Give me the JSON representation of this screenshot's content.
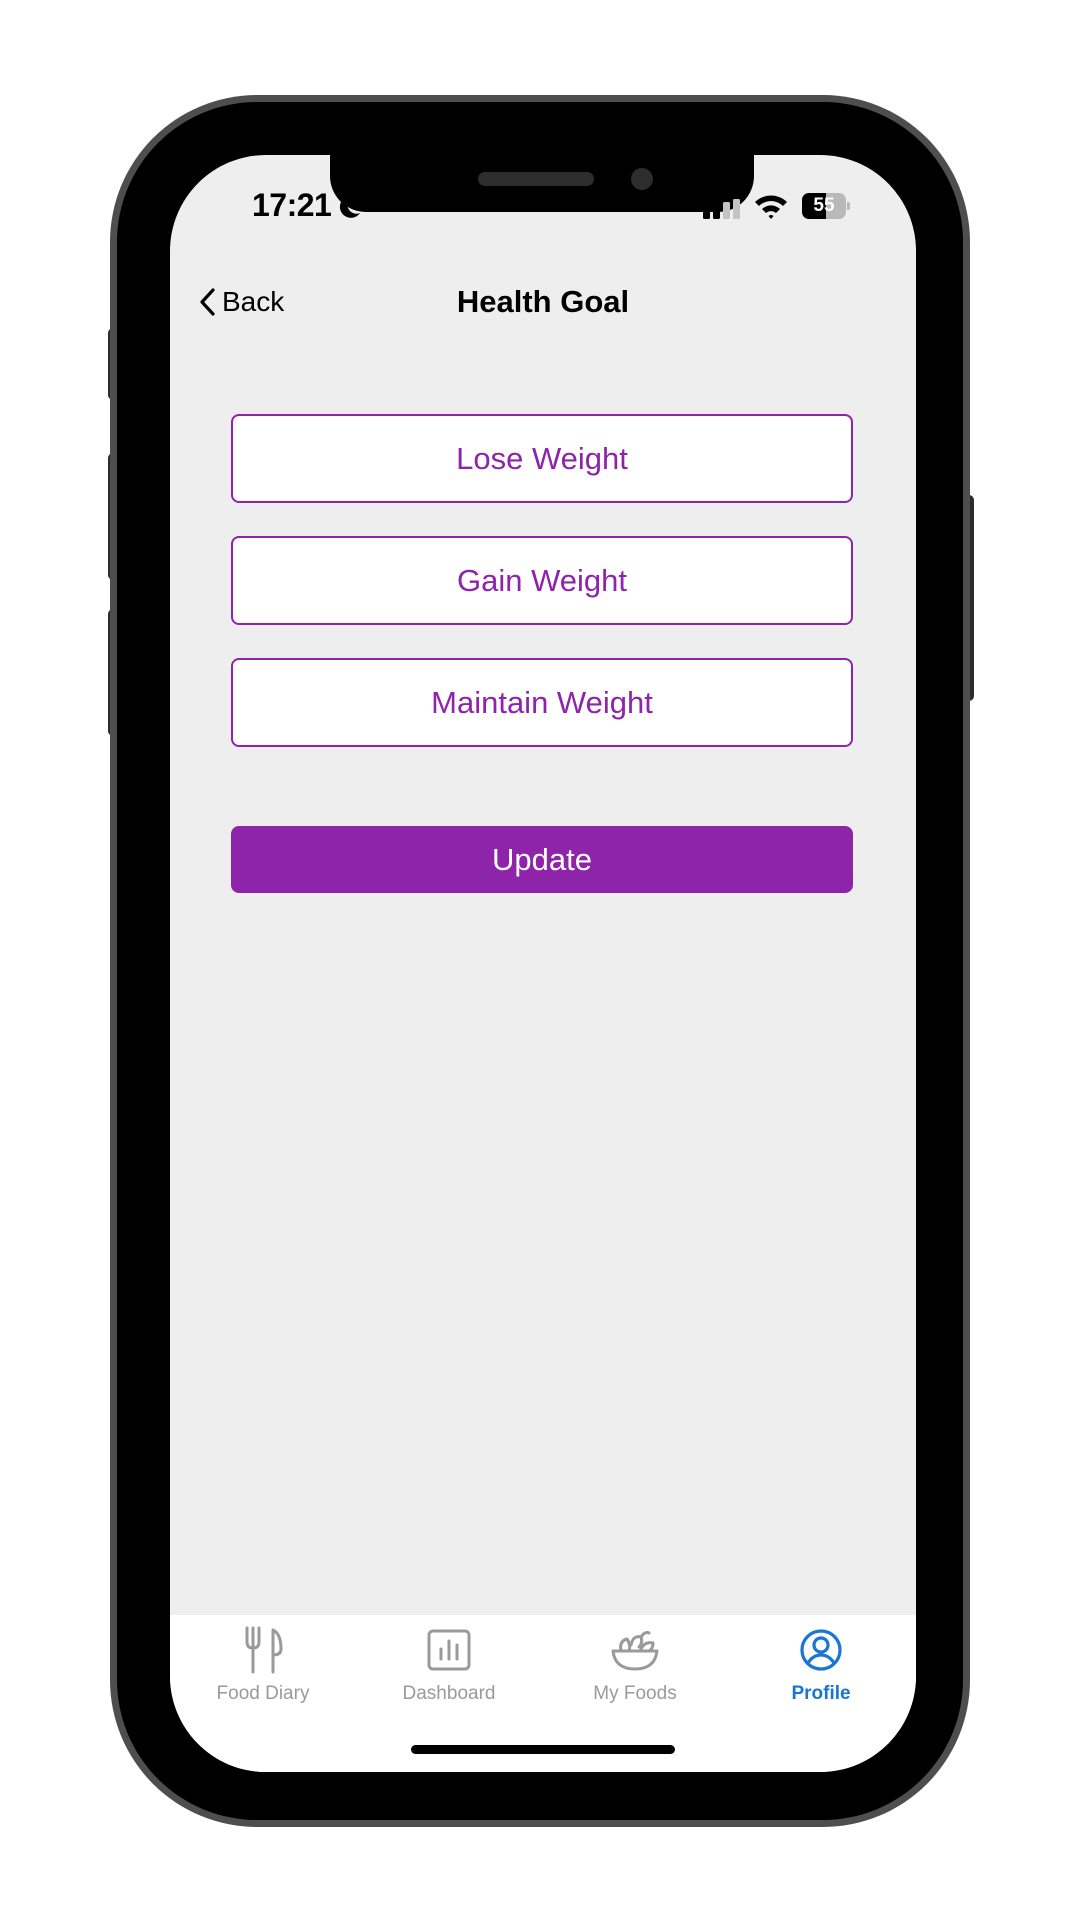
{
  "status_bar": {
    "time": "17:21",
    "battery_level": "55",
    "battery_fraction": 0.55
  },
  "nav": {
    "back_label": "Back",
    "title": "Health Goal"
  },
  "goal_options": [
    "Lose Weight",
    "Gain Weight",
    "Maintain Weight"
  ],
  "update_label": "Update",
  "tabs": [
    {
      "label": "Food Diary",
      "icon": "fork-knife-icon",
      "active": false
    },
    {
      "label": "Dashboard",
      "icon": "bar-chart-icon",
      "active": false
    },
    {
      "label": "My Foods",
      "icon": "salad-bowl-icon",
      "active": false
    },
    {
      "label": "Profile",
      "icon": "user-circle-icon",
      "active": true
    }
  ],
  "colors": {
    "accent": "#8e24aa",
    "tab_active": "#1976d2",
    "tab_inactive": "#9a9a9a",
    "screen_background": "#eeeeef"
  }
}
